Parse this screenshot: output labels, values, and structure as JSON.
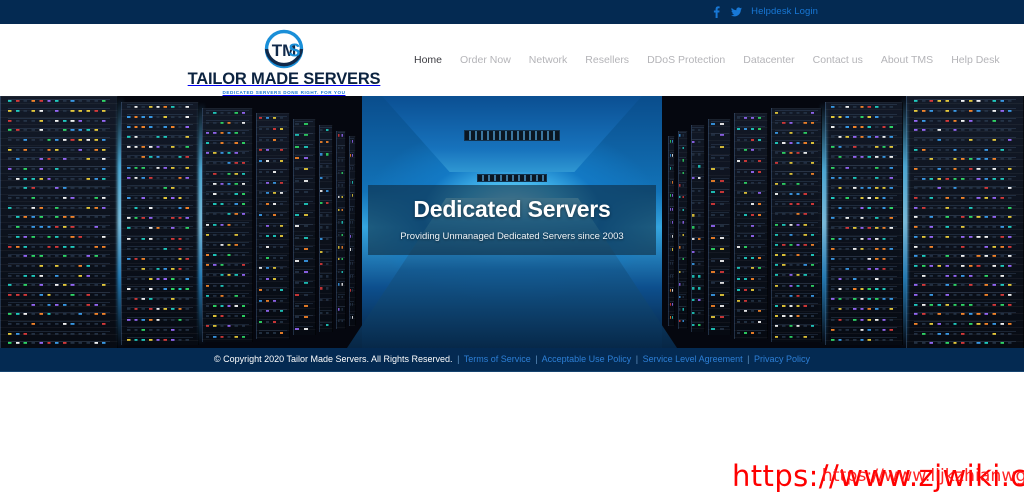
{
  "topbar": {
    "facebook_icon": "facebook-icon",
    "twitter_icon": "twitter-icon",
    "helpdesk_login": "Helpdesk Login"
  },
  "brand": {
    "monogram": "TMS",
    "name": "TAILOR MADE SERVERS",
    "tagline": "DEDICATED SERVERS DONE RIGHT. FOR YOU"
  },
  "nav": {
    "items": [
      {
        "label": "Home",
        "active": true
      },
      {
        "label": "Order Now",
        "active": false
      },
      {
        "label": "Network",
        "active": false
      },
      {
        "label": "Resellers",
        "active": false
      },
      {
        "label": "DDoS Protection",
        "active": false
      },
      {
        "label": "Datacenter",
        "active": false
      },
      {
        "label": "Contact us",
        "active": false
      },
      {
        "label": "About TMS",
        "active": false
      },
      {
        "label": "Help Desk",
        "active": false
      }
    ]
  },
  "hero": {
    "title": "Dedicated Servers",
    "subtitle": "Providing Unmanaged Dedicated Servers since 2003",
    "background_alt": "data-center-server-racks"
  },
  "footer": {
    "copyright": "© Copyright 2020 Tailor Made Servers. All Rights Reserved.",
    "links": [
      {
        "label": "Terms of Service"
      },
      {
        "label": "Acceptable Use Policy"
      },
      {
        "label": "Service Level Agreement"
      },
      {
        "label": "Privacy Policy"
      }
    ],
    "separator": "|"
  },
  "watermark": {
    "primary": "https://www.zjwiki.com",
    "secondary": "https://www.lijkzhianwg.cn"
  },
  "colors": {
    "navy": "#042a52",
    "link_blue": "#1878d6",
    "nav_muted": "#b4b4b8",
    "nav_active": "#3c3c42",
    "watermark_red": "#fe0000"
  }
}
